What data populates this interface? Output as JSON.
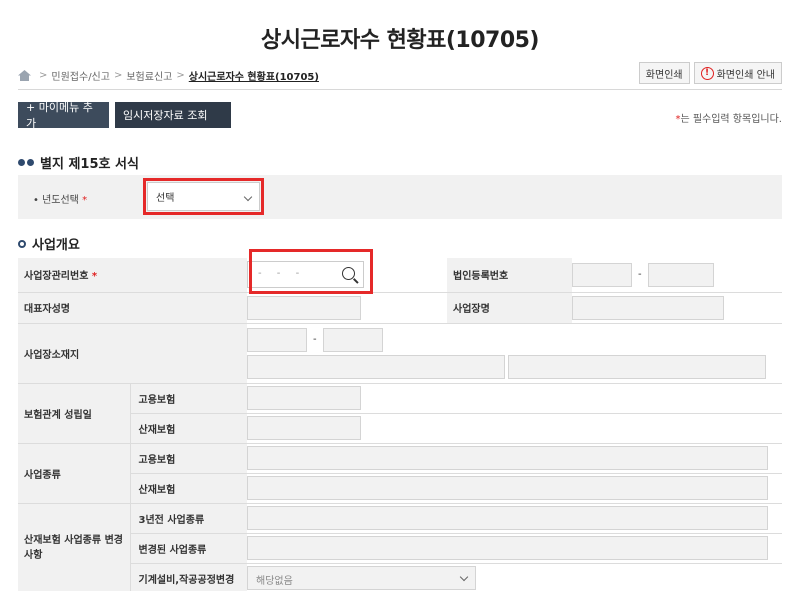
{
  "title": "상시근로자수 현황표(10705)",
  "breadcrumb": [
    "민원접수/신고",
    "보험료신고",
    "상시근로자수 현황표(10705)"
  ],
  "print_buttons": {
    "print": "화면인쇄",
    "print_guide": "화면인쇄 안내"
  },
  "actions": {
    "add_my_menu": "+ 마이메뉴 추가",
    "temp_data": "임시저장자료 조회"
  },
  "required_note": "는 필수입력 항목입니다.",
  "required_mark": "*",
  "section1": {
    "title": "별지 제15호 서식",
    "year_label": "년도선택",
    "year_value": "선택"
  },
  "section2": {
    "title": "사업개요",
    "biz_mgmt_no_label": "사업장관리번호",
    "biz_mgmt_no_placeholder": "- - -",
    "corp_reg_no_label": "법인등록번호",
    "rep_name_label": "대표자성명",
    "biz_name_label": "사업장명",
    "biz_address_label": "사업장소재지",
    "established_label": "보험관계 성립일",
    "employment_ins": "고용보험",
    "industrial_ins": "산재보험",
    "biz_type_label": "사업종류",
    "change_label": "산재보험 사업종류 변경사항",
    "three_years_ago": "3년전 사업종류",
    "changed_type": "변경된 사업종류",
    "equipment_change": "기계설비,작공공정변경",
    "equipment_value": "해당없음",
    "dash": "-"
  }
}
